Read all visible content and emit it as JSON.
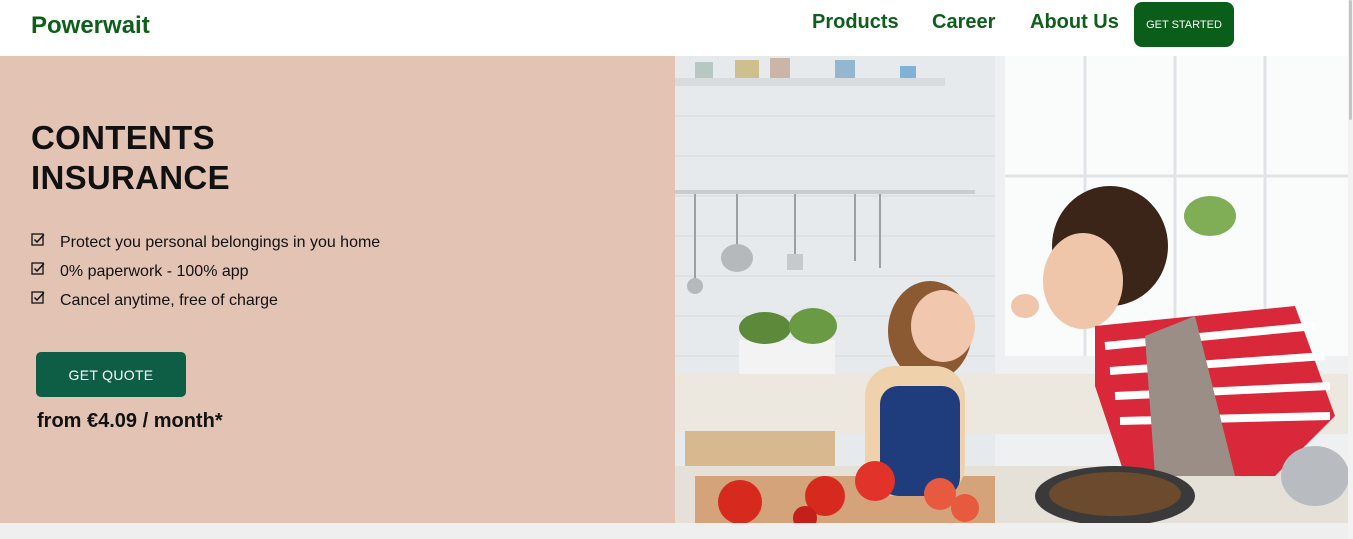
{
  "brand": {
    "name": "Powerwait"
  },
  "nav": {
    "links": [
      "Products",
      "Career",
      "About Us"
    ],
    "cta_label": "GET STARTED"
  },
  "hero": {
    "title": "CONTENTS INSURANCE",
    "features": [
      "Protect you personal belongings in you home",
      "0% paperwork - 100% app",
      "Cancel anytime, free of charge"
    ],
    "cta_label": "GET QUOTE",
    "price_text": "from €4.09 / month*",
    "image_description_icon": "kitchen-photo"
  },
  "colors": {
    "brand_green": "#0e5e1c",
    "button_green": "#0a5e1a",
    "quote_button": "#0e5e45",
    "hero_background": "#e2c3b4"
  }
}
